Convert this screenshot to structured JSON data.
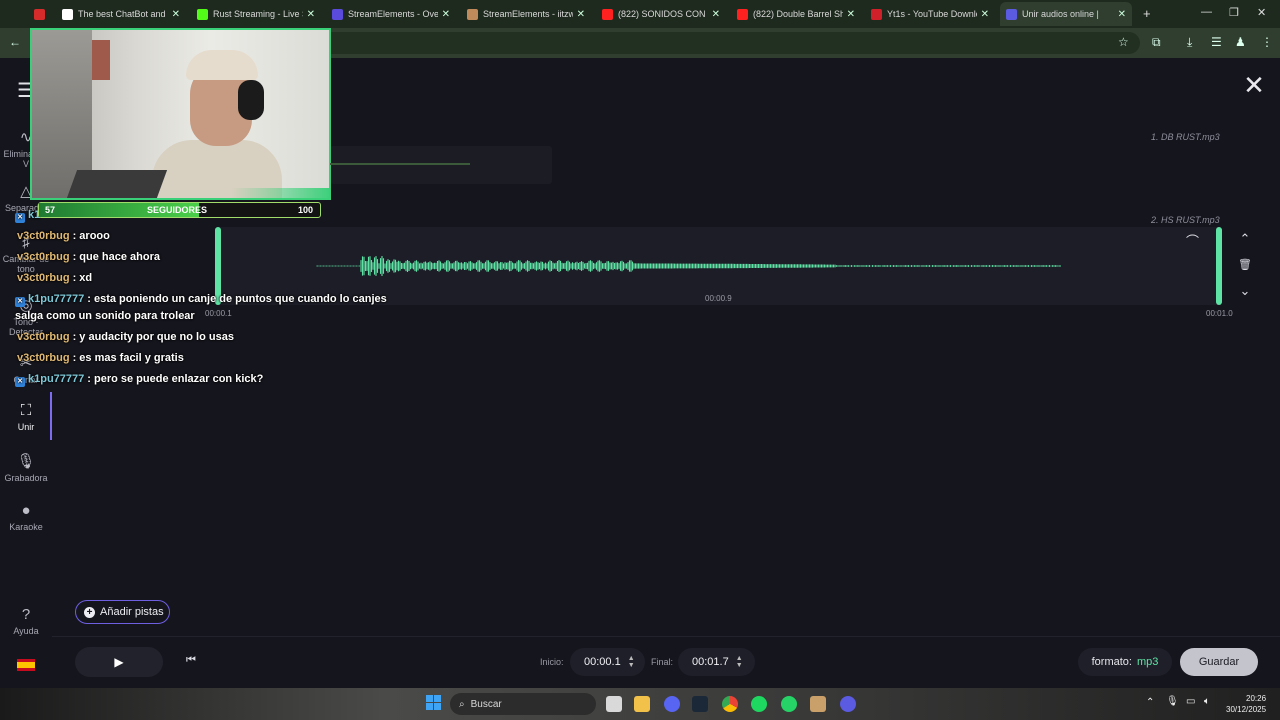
{
  "browser": {
    "tabs": [
      {
        "title": "",
        "color": "#d62b2b"
      },
      {
        "title": "The best ChatBot and W",
        "color": "#ffffff"
      },
      {
        "title": "Rust Streaming - Live St",
        "color": "#53fc18"
      },
      {
        "title": "StreamElements - Overla",
        "color": "#5a4bdc"
      },
      {
        "title": "StreamElements - iitzwo",
        "color": "#c08a5a"
      },
      {
        "title": "(822) SONIDOS CON PU",
        "color": "#ff2020"
      },
      {
        "title": "(822) Double Barrel Sho",
        "color": "#ff2020"
      },
      {
        "title": "Yt1s - YouTube Downloa",
        "color": "#d0202a"
      },
      {
        "title": "Unir audios online |",
        "color": "#5a5be0"
      }
    ],
    "new_tab": "+",
    "window_controls": [
      "minimize-icon",
      "maximize-icon",
      "close-icon"
    ]
  },
  "sidebar": {
    "items": [
      {
        "label": "Eliminar de V",
        "icon": "wave-icon"
      },
      {
        "label": "Separador",
        "icon": "split-icon"
      },
      {
        "label": "Cambiar de tono",
        "icon": "tone-icon"
      },
      {
        "label": "Tono · Detectar",
        "icon": "detect-icon"
      },
      {
        "label": "Cortar",
        "icon": "cut-icon"
      },
      {
        "label": "Unir",
        "icon": "join-icon"
      },
      {
        "label": "Grabadora",
        "icon": "mic-icon"
      },
      {
        "label": "Karaoke",
        "icon": "karaoke-icon"
      },
      {
        "label": "Ayuda",
        "icon": "help-icon"
      }
    ],
    "language_flag": "es-flag-icon"
  },
  "editor": {
    "tracks": [
      {
        "name": "1. DB RUST.mp3"
      },
      {
        "name": "2. HS RUST.mp3"
      }
    ],
    "timeline": {
      "start_marker": "00:00.1",
      "mid_marker": "00:00.9",
      "end_marker": "00:01.0"
    }
  },
  "bottom": {
    "add_tracks": "Añadir pistas",
    "start_label": "Inicio:",
    "start_value": "00:00.1",
    "end_label": "Final:",
    "end_value": "00:01.7",
    "format_label": "formato:",
    "format_value": "mp3",
    "save": "Guardar"
  },
  "chat": [
    {
      "user": "k1",
      "text": "",
      "badge": true,
      "user_color": "#7ec8d8"
    },
    {
      "user": "v3ct0rbug",
      "text": ": arooo",
      "badge": false,
      "user_color": "#e0b974"
    },
    {
      "user": "v3ct0rbug",
      "text": ": que hace ahora",
      "badge": false,
      "user_color": "#e0b974"
    },
    {
      "user": "v3ct0rbug",
      "text": ": xd",
      "badge": false,
      "user_color": "#e0b974"
    },
    {
      "user": "k1pu77777",
      "text": ": esta poniendo un canje de puntos que cuando lo canjes",
      "badge": true,
      "user_color": "#7ec8d8"
    },
    {
      "user": "",
      "text": "salga como un sonido para trolear",
      "badge": false,
      "user_color": "#ffffff"
    },
    {
      "user": "v3ct0rbug",
      "text": ": y audacity por que no lo usas",
      "badge": false,
      "user_color": "#e0b974"
    },
    {
      "user": "v3ct0rbug",
      "text": ": es mas facil y gratis",
      "badge": false,
      "user_color": "#e0b974"
    },
    {
      "user": "k1pu77777",
      "text": ": pero se puede enlazar con kick?",
      "badge": true,
      "user_color": "#7ec8d8"
    }
  ],
  "overlay": {
    "followers_current": "57",
    "followers_label": "SEGUIDORES",
    "followers_goal": "100",
    "followers_progress": 0.57
  },
  "taskbar": {
    "search_placeholder": "Buscar",
    "time": "20:26",
    "date": "30/12/2025"
  },
  "colors": {
    "accent": "#5fe3a5",
    "purple": "#6e5fe0"
  }
}
